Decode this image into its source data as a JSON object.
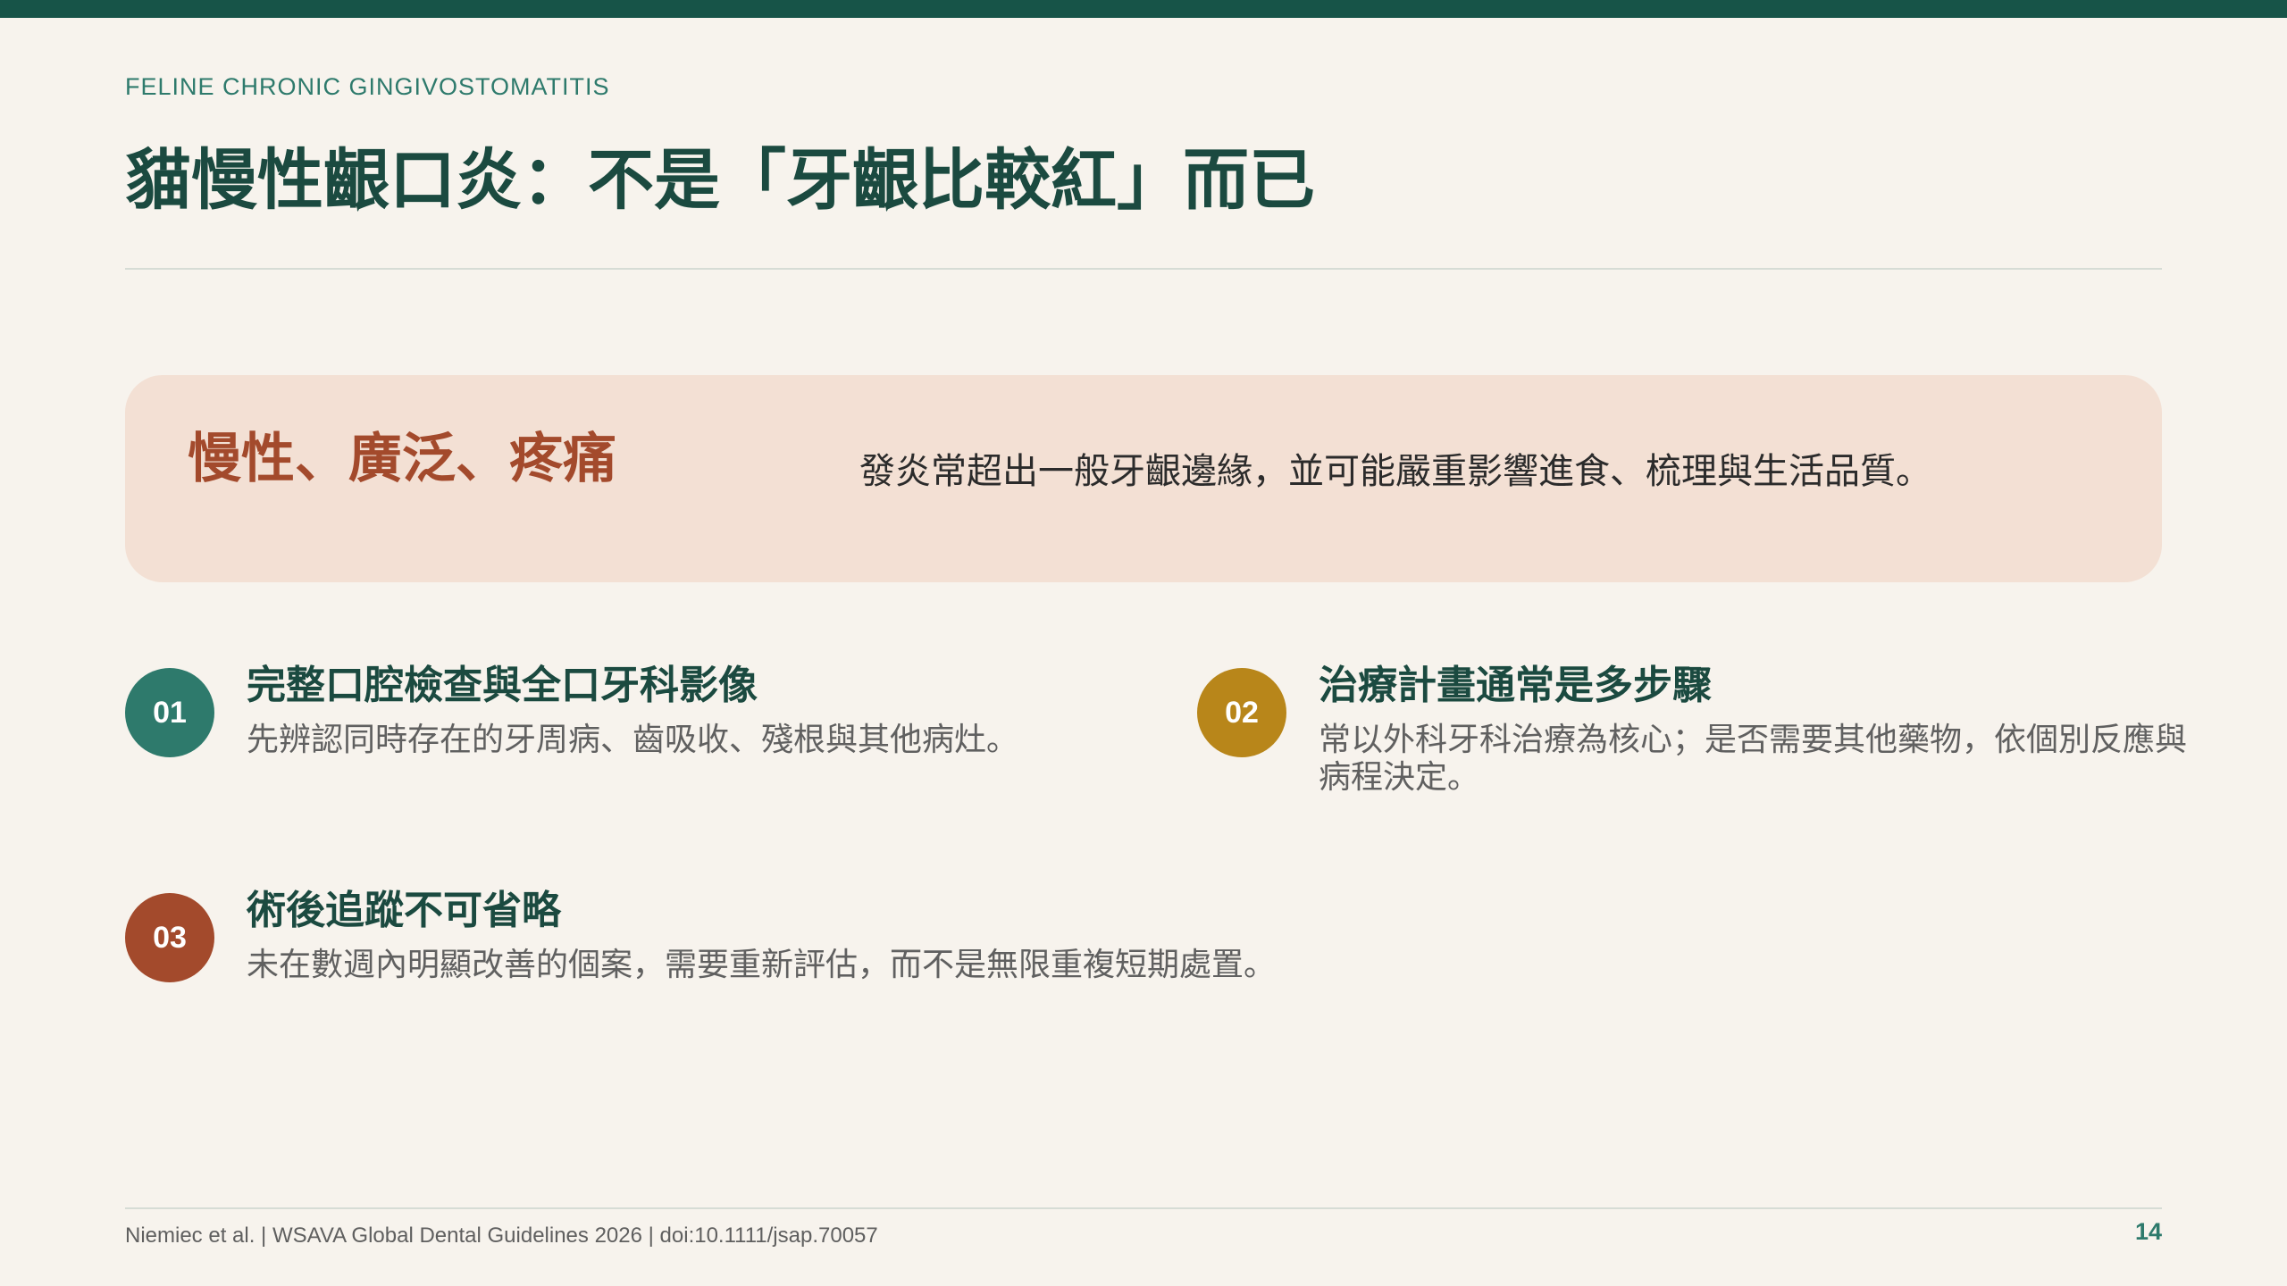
{
  "header": {
    "eyebrow": "FELINE CHRONIC GINGIVOSTOMATITIS",
    "title": "貓慢性齦口炎：不是「牙齦比較紅」而已"
  },
  "callout": {
    "heading": "慢性、廣泛、疼痛",
    "body": "發炎常超出一般牙齦邊緣，並可能嚴重影響進食、梳理與生活品質。"
  },
  "items": [
    {
      "number": "01",
      "title": "完整口腔檢查與全口牙科影像",
      "text": "先辨認同時存在的牙周病、齒吸收、殘根與其他病灶。",
      "color": "#2e7a6c"
    },
    {
      "number": "02",
      "title": "治療計畫通常是多步驟",
      "text": "常以外科牙科治療為核心；是否需要其他藥物，依個別反應與病程決定。",
      "color": "#b8861a"
    },
    {
      "number": "03",
      "title": "術後追蹤不可省略",
      "text": "未在數週內明顯改善的個案，需要重新評估，而不是無限重複短期處置。",
      "color": "#a34a2c"
    }
  ],
  "footer": {
    "citation": "Niemiec et al. | WSAVA Global Dental Guidelines 2026 | doi:10.1111/jsap.70057",
    "page_number": "14"
  },
  "colors": {
    "background": "#f7f3ed",
    "top_bar": "#175448",
    "title": "#1b4a40",
    "accent_teal": "#2e7a6c",
    "accent_gold": "#b8861a",
    "accent_rust": "#a34a2c",
    "callout_bg": "#f3e0d4"
  }
}
